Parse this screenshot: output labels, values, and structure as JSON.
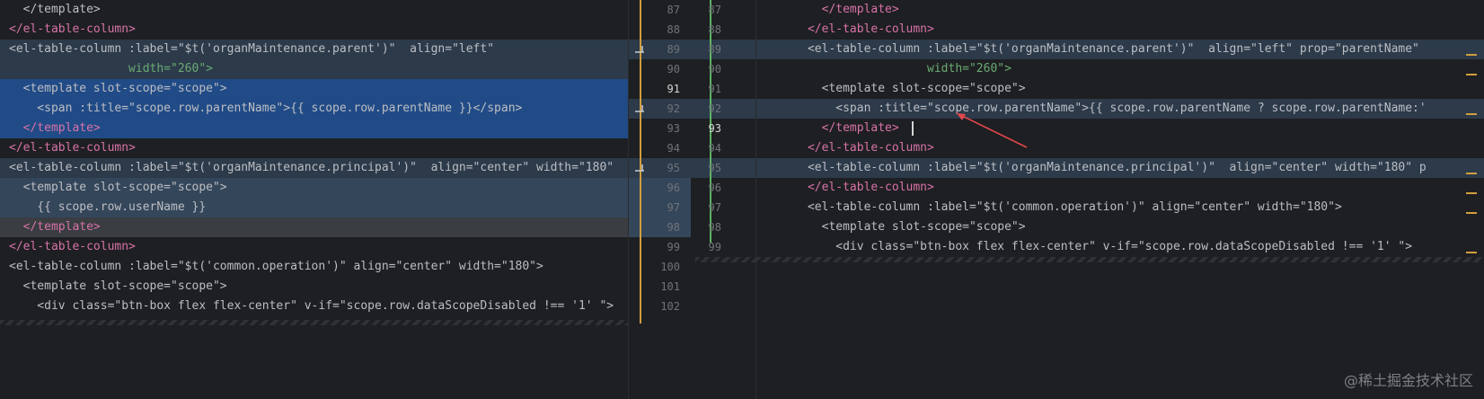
{
  "editor": {
    "left_lines": [
      {
        "text": "  </template>"
      },
      {
        "text": "</el-table-column>"
      },
      {
        "text": "<el-table-column :label=\"$t('organMaintenance.parent')\"  align=\"left\""
      },
      {
        "text": "                 width=\"260\">"
      },
      {
        "text": "  <template slot-scope=\"scope\">"
      },
      {
        "text": "    <span :title=\"scope.row.parentName\">{{ scope.row.parentName }}</span>"
      },
      {
        "text": "  </template>"
      },
      {
        "text": "</el-table-column>"
      },
      {
        "text": "<el-table-column :label=\"$t('organMaintenance.principal')\"  align=\"center\" width=\"180\""
      },
      {
        "text": "  <template slot-scope=\"scope\">"
      },
      {
        "text": "    {{ scope.row.userName }}"
      },
      {
        "text": "  </template>"
      },
      {
        "text": "</el-table-column>"
      },
      {
        "text": "<el-table-column :label=\"$t('common.operation')\" align=\"center\" width=\"180\">"
      },
      {
        "text": "  <template slot-scope=\"scope\">"
      },
      {
        "text": "    <div class=\"btn-box flex flex-center\" v-if=\"scope.row.dataScopeDisabled !== '1' \">"
      }
    ],
    "right_lines": [
      {
        "text": "        </template>"
      },
      {
        "text": "      </el-table-column>"
      },
      {
        "text": "      <el-table-column :label=\"$t('organMaintenance.parent')\"  align=\"left\" prop=\"parentName\""
      },
      {
        "text": "                       width=\"260\">"
      },
      {
        "text": "        <template slot-scope=\"scope\">"
      },
      {
        "text": "          <span :title=\"scope.row.parentName\">{{ scope.row.parentName ? scope.row.parentName:'"
      },
      {
        "text": "        </template>"
      },
      {
        "text": "      </el-table-column>"
      },
      {
        "text": "      <el-table-column :label=\"$t('organMaintenance.principal')\"  align=\"center\" width=\"180\" p"
      },
      {
        "text": "      </el-table-column>"
      },
      {
        "text": "      <el-table-column :label=\"$t('common.operation')\" align=\"center\" width=\"180\">"
      },
      {
        "text": "        <template slot-scope=\"scope\">"
      },
      {
        "text": "          <div class=\"btn-box flex flex-center\" v-if=\"scope.row.dataScopeDisabled !== '1' \">"
      }
    ],
    "gutter_left_numbers": [
      "87",
      "88",
      "89",
      "90",
      "91",
      "92",
      "93",
      "94",
      "95",
      "96",
      "97",
      "98",
      "99",
      "100",
      "101",
      "102"
    ],
    "gutter_right_numbers": [
      "87",
      "88",
      "89",
      "90",
      "91",
      "92",
      "93",
      "94",
      "95",
      "96",
      "97",
      "98",
      "99"
    ],
    "active_left": "91",
    "active_right": "93"
  },
  "watermark": "@稀土掘金技术社区",
  "colors": {
    "background": "#1e1f22",
    "modified": "#2c3a4a",
    "modified_strong": "#214b86",
    "marker": "#d19e3d",
    "arrow": "#e0474c"
  }
}
